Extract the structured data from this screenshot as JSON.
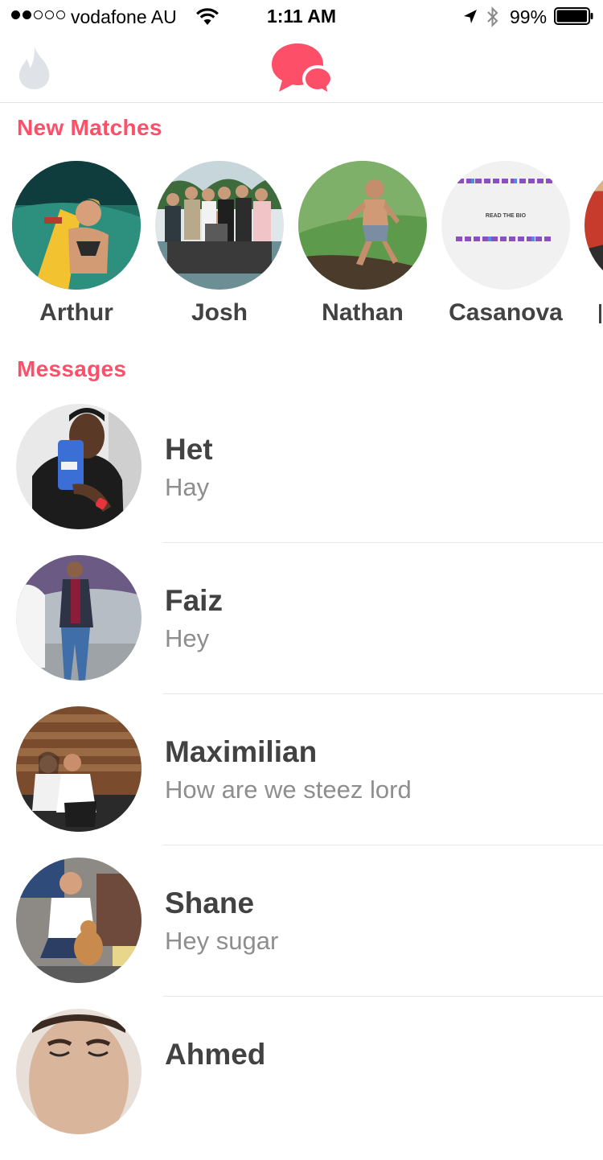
{
  "status_bar": {
    "signal_dots": [
      true,
      true,
      false,
      false,
      false
    ],
    "carrier": "vodafone AU",
    "time": "1:11 AM",
    "battery_percent": "99%",
    "battery_level": 0.99,
    "icons": [
      "wifi-icon",
      "location-arrow-icon",
      "bluetooth-icon",
      "battery-icon"
    ]
  },
  "nav": {
    "left_icon": "flame-icon",
    "center_icon": "chat-bubbles-icon",
    "active_color": "#fd5068",
    "inactive_color": "#dfe3e8"
  },
  "new_matches": {
    "title": "New Matches",
    "items": [
      {
        "name": "Arthur"
      },
      {
        "name": "Josh"
      },
      {
        "name": "Nathan"
      },
      {
        "name": "Casanova"
      },
      {
        "name": ""
      }
    ]
  },
  "messages": {
    "title": "Messages",
    "items": [
      {
        "name": "Het",
        "preview": "Hay"
      },
      {
        "name": "Faiz",
        "preview": "Hey"
      },
      {
        "name": "Maximilian",
        "preview": "How are we steez lord"
      },
      {
        "name": "Shane",
        "preview": "Hey sugar"
      },
      {
        "name": "Ahmed",
        "preview": ""
      }
    ]
  },
  "casanova_card": {
    "center_text": "READ THE BIO"
  },
  "colors": {
    "accent": "#fd5068",
    "name_text": "#424242",
    "preview_text": "#8e8e8e",
    "divider": "#e6e6e6"
  }
}
